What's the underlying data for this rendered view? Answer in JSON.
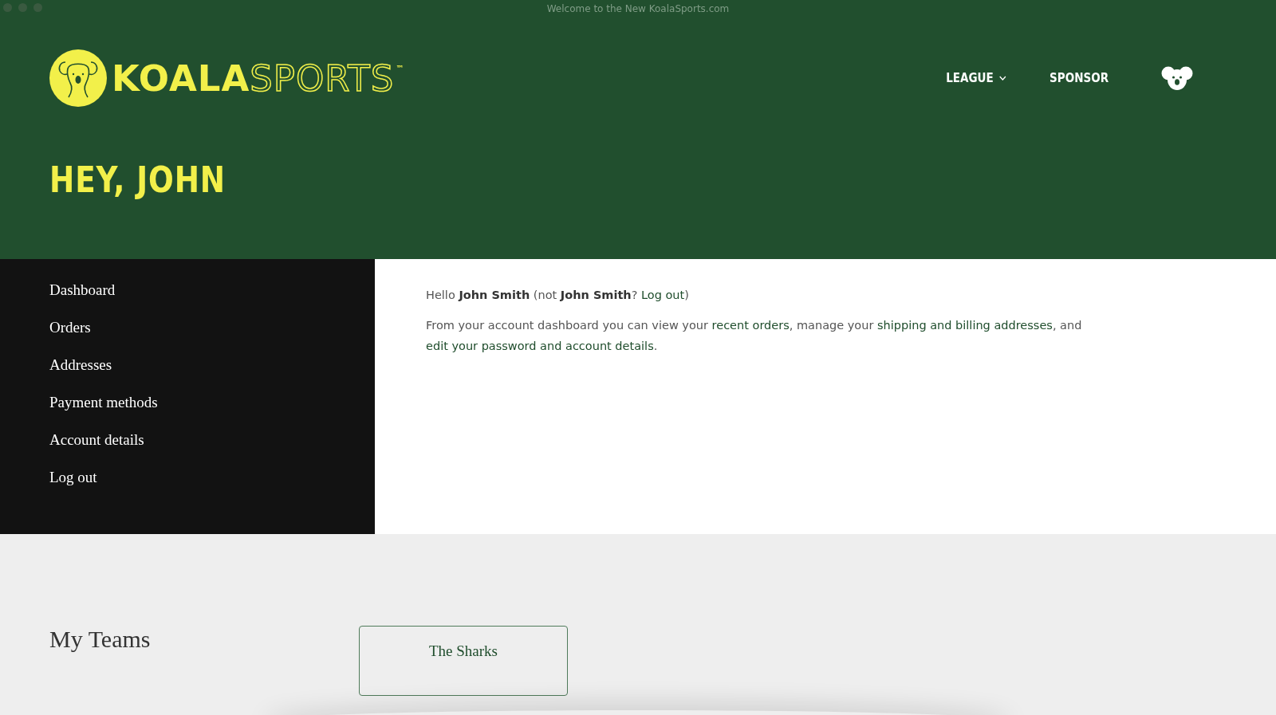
{
  "window": {
    "title": "Welcome to the New KoalaSports.com"
  },
  "header": {
    "logo": {
      "word_1": "KOALA",
      "word_2": "SPORTS",
      "mark": "™"
    },
    "nav": [
      {
        "label": "LEAGUE",
        "kind": "dropdown"
      },
      {
        "label": "SPONSOR",
        "kind": "link"
      }
    ],
    "heading": "HEY, JOHN"
  },
  "sidebar": {
    "items": [
      {
        "label": "Dashboard"
      },
      {
        "label": "Orders"
      },
      {
        "label": "Addresses"
      },
      {
        "label": "Payment methods"
      },
      {
        "label": "Account details"
      },
      {
        "label": "Log out"
      }
    ]
  },
  "content": {
    "paragraphs": [
      [
        {
          "kind": "plain",
          "text": "Hello "
        },
        {
          "kind": "bold",
          "text": "John Smith"
        },
        {
          "kind": "plain",
          "text": " (not "
        },
        {
          "kind": "bold",
          "text": "John Smith"
        },
        {
          "kind": "plain",
          "text": "? "
        },
        {
          "kind": "link",
          "text": "Log out"
        },
        {
          "kind": "plain",
          "text": ")"
        }
      ],
      [
        {
          "kind": "plain",
          "text": "From your account dashboard you can view your "
        },
        {
          "kind": "link",
          "text": "recent orders"
        },
        {
          "kind": "plain",
          "text": ", manage your "
        },
        {
          "kind": "link",
          "text": "shipping and billing addresses"
        },
        {
          "kind": "plain",
          "text": ", and "
        },
        {
          "kind": "link",
          "text": "edit your password and account details"
        },
        {
          "kind": "plain",
          "text": "."
        }
      ]
    ]
  },
  "teams": {
    "heading": "My Teams",
    "items": [
      {
        "name": "The Sharks"
      }
    ]
  }
}
